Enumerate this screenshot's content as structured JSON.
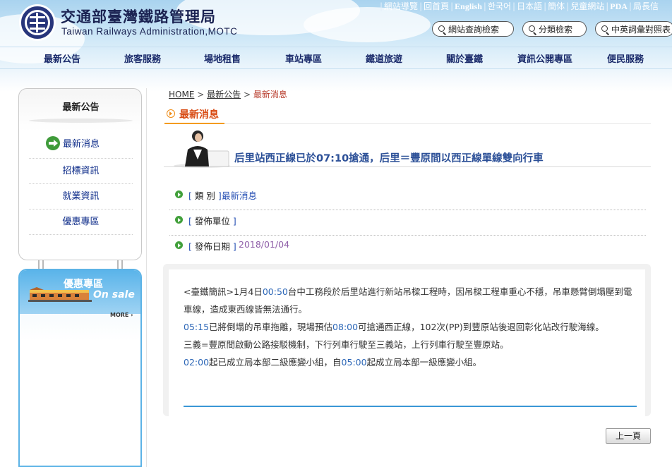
{
  "header": {
    "org_zh": "交通部臺灣鐵路管理局",
    "org_en": "Taiwan Railways Administration,MOTC",
    "top_links": [
      "網站導覽",
      "回首頁",
      "English",
      "한국어",
      "日本語",
      "簡体",
      "兒童網站",
      "PDA",
      "局長信"
    ],
    "buttons": {
      "site_search": "網站查詢檢索",
      "category_search": "分類檢索",
      "term_search": "中英詞彙對照表"
    }
  },
  "nav": [
    "最新公告",
    "旅客服務",
    "場地租售",
    "車站專區",
    "鐵道旅遊",
    "關於臺鐵",
    "資訊公開專區",
    "便民服務"
  ],
  "sidebar": {
    "title": "最新公告",
    "items": [
      "最新消息",
      "招標資訊",
      "就業資訊",
      "優惠專區"
    ],
    "promo_zh": "優惠專區",
    "promo_en": "On sale",
    "more": "MORE"
  },
  "breadcrumb": {
    "home": "HOME",
    "sep": ">",
    "level1": "最新公告",
    "current": "最新消息"
  },
  "page_title": "最新消息",
  "article": {
    "title": "后里站西正線已於07:10搶通，后里＝豐原間以西正線單線雙向行車",
    "meta": [
      {
        "label_open": "[",
        "label": "類 別",
        "label_close": "]",
        "value": "最新消息"
      },
      {
        "label_open": "[",
        "label": "發佈單位",
        "label_close": "]",
        "value": ""
      },
      {
        "label_open": "[",
        "label": "發佈日期",
        "label_close": "]",
        "value": "2018/01/04"
      }
    ],
    "body": {
      "l1a": "<臺鐵簡訊>1月4日",
      "l1t": "00:50",
      "l1b": "台中工務段於后里站進行新站吊樑工程時，因吊樑工程車重心不穩，吊車懸臂倒塌壓到電",
      "l2": "車線，造成東西線皆無法通行。",
      "l3t": "05:15",
      "l3a": "已將倒塌的吊車拖離，現場預估",
      "l3t2": "08:00",
      "l3b": "可搶通西正線，102次(PP)到豐原站後退回彰化站改行駛海線。",
      "l4": "三義=豐原間啟動公路接駁機制，下行列車行駛至三義站，上行列車行駛至豐原站。",
      "l5t": "02:00",
      "l5a": "起已成立局本部二級應變小組，自",
      "l5t2": "05:00",
      "l5b": "起成立局本部一級應變小組。"
    }
  },
  "back_button": "上一頁",
  "colors": {
    "nav_text": "#1b2b6b",
    "accent_orange": "#d84a12",
    "title_blue": "#2b4f97",
    "bullet_green": "#42a03b",
    "rule_blue": "#3a97d6"
  }
}
